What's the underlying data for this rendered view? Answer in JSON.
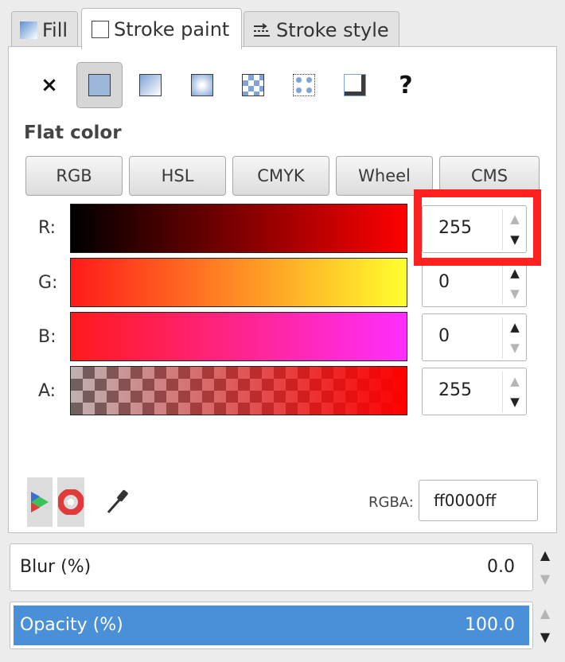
{
  "tabs": [
    {
      "label": "Fill",
      "icon": "fill-gradient-icon"
    },
    {
      "label": "Stroke paint",
      "icon": "stroke-paint-icon"
    },
    {
      "label": "Stroke style",
      "icon": "stroke-style-icon"
    }
  ],
  "paint_types": [
    "no-paint-icon",
    "flat-color-icon",
    "linear-gradient-icon",
    "radial-gradient-icon",
    "pattern-icon",
    "swatch-icon",
    "mesh-icon",
    "unset-paint-icon"
  ],
  "heading": "Flat color",
  "modes": [
    "RGB",
    "HSL",
    "CMYK",
    "Wheel",
    "CMS"
  ],
  "channels": [
    {
      "label": "R:",
      "value": "255"
    },
    {
      "label": "G:",
      "value": "0"
    },
    {
      "label": "B:",
      "value": "0"
    },
    {
      "label": "A:",
      "value": "255"
    }
  ],
  "bottom_tools": [
    "color-scales-icon",
    "color-wheel-icon",
    "eyedropper-icon"
  ],
  "rgba": {
    "label": "RGBA:",
    "value": "ff0000ff"
  },
  "blur": {
    "label": "Blur (%)",
    "value": "0.0"
  },
  "opacity": {
    "label": "Opacity (%)",
    "value": "100.0"
  },
  "colors": {
    "accent": "#4a90d9",
    "highlight": "#ff2020"
  }
}
